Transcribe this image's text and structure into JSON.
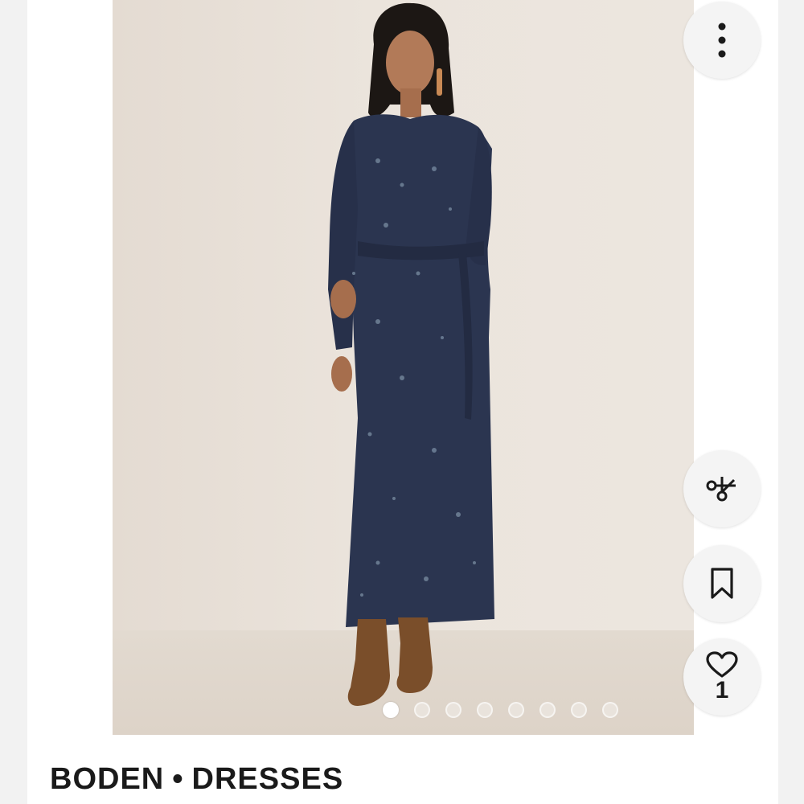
{
  "listing": {
    "brand": "BODEN",
    "separator": "•",
    "category": "DRESSES"
  },
  "carousel": {
    "total_images": 8,
    "active_index": 0
  },
  "actions": {
    "more_icon": "more-vertical-icon",
    "share_icon": "share-icon",
    "bookmark_icon": "bookmark-icon",
    "like_icon": "heart-icon",
    "like_count": "1"
  },
  "colors": {
    "dress": "#2b3550",
    "boots": "#7a4e2a",
    "backdrop": "#ebe4dc",
    "button_bg": "#f4f4f4"
  }
}
